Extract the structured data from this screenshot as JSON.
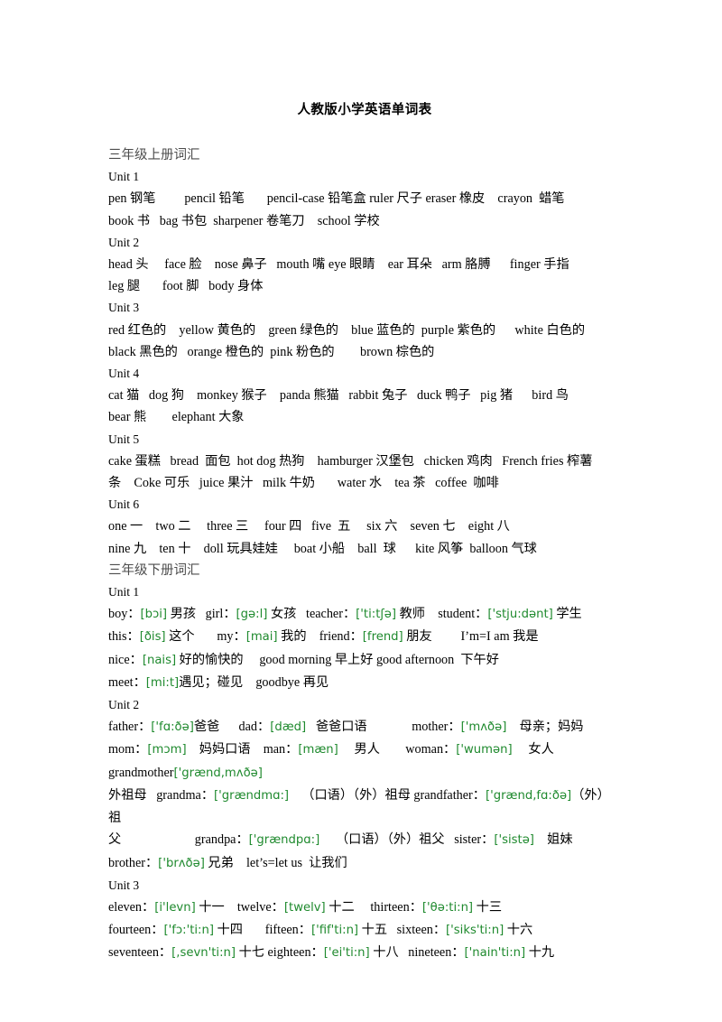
{
  "document": {
    "title": "人教版小学英语单词表",
    "phonetic_color": "#1f8a2e",
    "text_color": "#000000",
    "section_head_color": "#4d4d4d"
  },
  "sections": [
    {
      "heading": "三年级上册词汇",
      "units": [
        {
          "label": "Unit 1",
          "lines": [
            "pen 钢笔         pencil 铅笔       pencil-case 铅笔盒 ruler 尺子 eraser 橡皮    crayon  蜡笔",
            "book 书   bag 书包  sharpener 卷笔刀    school 学校"
          ]
        },
        {
          "label": "Unit 2",
          "lines": [
            "head 头     face 脸    nose 鼻子   mouth 嘴 eye 眼睛    ear 耳朵   arm 胳膊      finger 手指",
            "leg 腿       foot 脚   body 身体"
          ]
        },
        {
          "label": "Unit 3",
          "lines": [
            "red 红色的    yellow 黄色的    green 绿色的    blue 蓝色的  purple 紫色的      white 白色的",
            "black 黑色的   orange 橙色的  pink 粉色的        brown 棕色的"
          ]
        },
        {
          "label": "Unit 4",
          "lines": [
            "cat 猫   dog 狗    monkey 猴子    panda 熊猫   rabbit 兔子   duck 鸭子   pig 猪      bird 鸟",
            "bear 熊        elephant 大象"
          ]
        },
        {
          "label": "Unit 5",
          "lines": [
            "cake 蛋糕   bread  面包  hot dog 热狗    hamburger 汉堡包   chicken 鸡肉   French fries 榨薯",
            "条    Coke 可乐   juice 果汁   milk 牛奶       water 水    tea 茶   coffee  咖啡"
          ]
        },
        {
          "label": "Unit 6",
          "lines": [
            "one 一    two 二     three 三     four 四   five  五     six 六    seven 七    eight 八",
            "nine 九    ten 十    doll 玩具娃娃     boat 小船    ball  球      kite 风筝  balloon 气球"
          ]
        }
      ]
    },
    {
      "heading": "三年级下册词汇",
      "units": [
        {
          "label": "Unit 1",
          "lines_rich": [
            [
              {
                "t": "boy：",
                "k": "en"
              },
              {
                "t": "[bɔi]",
                "k": "ph"
              },
              {
                "t": " 男孩   ",
                "k": "en"
              },
              {
                "t": "girl：",
                "k": "en"
              },
              {
                "t": "[gə:l]",
                "k": "ph"
              },
              {
                "t": " 女孩   ",
                "k": "en"
              },
              {
                "t": "teacher：",
                "k": "en"
              },
              {
                "t": "['ti:tʃə]",
                "k": "ph"
              },
              {
                "t": " 教师    ",
                "k": "en"
              },
              {
                "t": "student：",
                "k": "en"
              },
              {
                "t": "['stju:dənt]",
                "k": "ph"
              },
              {
                "t": " 学生",
                "k": "en"
              }
            ],
            [
              {
                "t": "this：",
                "k": "en"
              },
              {
                "t": "[ðis]",
                "k": "ph"
              },
              {
                "t": " 这个       ",
                "k": "en"
              },
              {
                "t": "my：",
                "k": "en"
              },
              {
                "t": "[mai]",
                "k": "ph"
              },
              {
                "t": " 我的    ",
                "k": "en"
              },
              {
                "t": "friend：",
                "k": "en"
              },
              {
                "t": "[frend]",
                "k": "ph"
              },
              {
                "t": " 朋友         I’m=I am 我是",
                "k": "en"
              }
            ],
            [
              {
                "t": "nice：",
                "k": "en"
              },
              {
                "t": "[nais]",
                "k": "ph"
              },
              {
                "t": " 好的愉快的     good morning 早上好 good afternoon  下午好",
                "k": "en"
              }
            ],
            [
              {
                "t": "meet：",
                "k": "en"
              },
              {
                "t": "[mi:t]",
                "k": "ph"
              },
              {
                "t": "遇见；碰见    goodbye 再见",
                "k": "en"
              }
            ]
          ]
        },
        {
          "label": "Unit 2",
          "lines_rich": [
            [
              {
                "t": "father：",
                "k": "en"
              },
              {
                "t": "['fɑ:ðə]",
                "k": "ph"
              },
              {
                "t": "爸爸      dad：",
                "k": "en"
              },
              {
                "t": "[dæd]",
                "k": "ph"
              },
              {
                "t": "   爸爸口语              mother：",
                "k": "en"
              },
              {
                "t": "['mʌðə]",
                "k": "ph"
              },
              {
                "t": "    母亲；妈妈",
                "k": "en"
              }
            ],
            [
              {
                "t": "mom：",
                "k": "en"
              },
              {
                "t": "[mɔm]",
                "k": "ph"
              },
              {
                "t": "    妈妈口语    man：",
                "k": "en"
              },
              {
                "t": "[mæn]",
                "k": "ph"
              },
              {
                "t": "     男人        woman：",
                "k": "en"
              },
              {
                "t": "['wumən]",
                "k": "ph"
              },
              {
                "t": "     女人",
                "k": "en"
              }
            ],
            [
              {
                "t": "grandmother",
                "k": "en"
              },
              {
                "t": "['grænd,mʌðə]",
                "k": "ph"
              }
            ],
            [
              {
                "t": "外祖母   grandma：",
                "k": "en"
              },
              {
                "t": "['grændmɑ:]",
                "k": "ph"
              },
              {
                "t": "    （口语）（外）祖母 grandfather：",
                "k": "en"
              },
              {
                "t": "['grænd,fɑ:ðə]",
                "k": "ph"
              },
              {
                "t": "（外）祖",
                "k": "en"
              }
            ],
            [
              {
                "t": "父                       grandpa：",
                "k": "en"
              },
              {
                "t": "['grændpɑ:]",
                "k": "ph"
              },
              {
                "t": "     （口语）（外）祖父   sister：",
                "k": "en"
              },
              {
                "t": "['sistə]",
                "k": "ph"
              },
              {
                "t": "    姐妹",
                "k": "en"
              }
            ],
            [
              {
                "t": "brother：",
                "k": "en"
              },
              {
                "t": "['brʌðə]",
                "k": "ph"
              },
              {
                "t": " 兄弟    let’s=let us  让我们",
                "k": "en"
              }
            ]
          ]
        },
        {
          "label": "Unit 3",
          "lines_rich": [
            [
              {
                "t": "eleven：",
                "k": "en"
              },
              {
                "t": "[i'levn]",
                "k": "ph"
              },
              {
                "t": " 十一    twelve：",
                "k": "en"
              },
              {
                "t": "[twelv]",
                "k": "ph"
              },
              {
                "t": " 十二     thirteen：",
                "k": "en"
              },
              {
                "t": "['θə:ti:n]",
                "k": "ph"
              },
              {
                "t": " 十三",
                "k": "en"
              }
            ],
            [
              {
                "t": "fourteen：",
                "k": "en"
              },
              {
                "t": "['fɔ:'ti:n]",
                "k": "ph"
              },
              {
                "t": " 十四       fifteen：",
                "k": "en"
              },
              {
                "t": "['fif'ti:n]",
                "k": "ph"
              },
              {
                "t": " 十五   sixteen：",
                "k": "en"
              },
              {
                "t": "['siks'ti:n]",
                "k": "ph"
              },
              {
                "t": " 十六",
                "k": "en"
              }
            ],
            [
              {
                "t": "seventeen：",
                "k": "en"
              },
              {
                "t": "[,sevn'ti:n]",
                "k": "ph"
              },
              {
                "t": " 十七 eighteen：",
                "k": "en"
              },
              {
                "t": "['ei'ti:n]",
                "k": "ph"
              },
              {
                "t": " 十八   nineteen：",
                "k": "en"
              },
              {
                "t": "['nain'ti:n]",
                "k": "ph"
              },
              {
                "t": " 十九",
                "k": "en"
              }
            ]
          ]
        }
      ]
    }
  ]
}
